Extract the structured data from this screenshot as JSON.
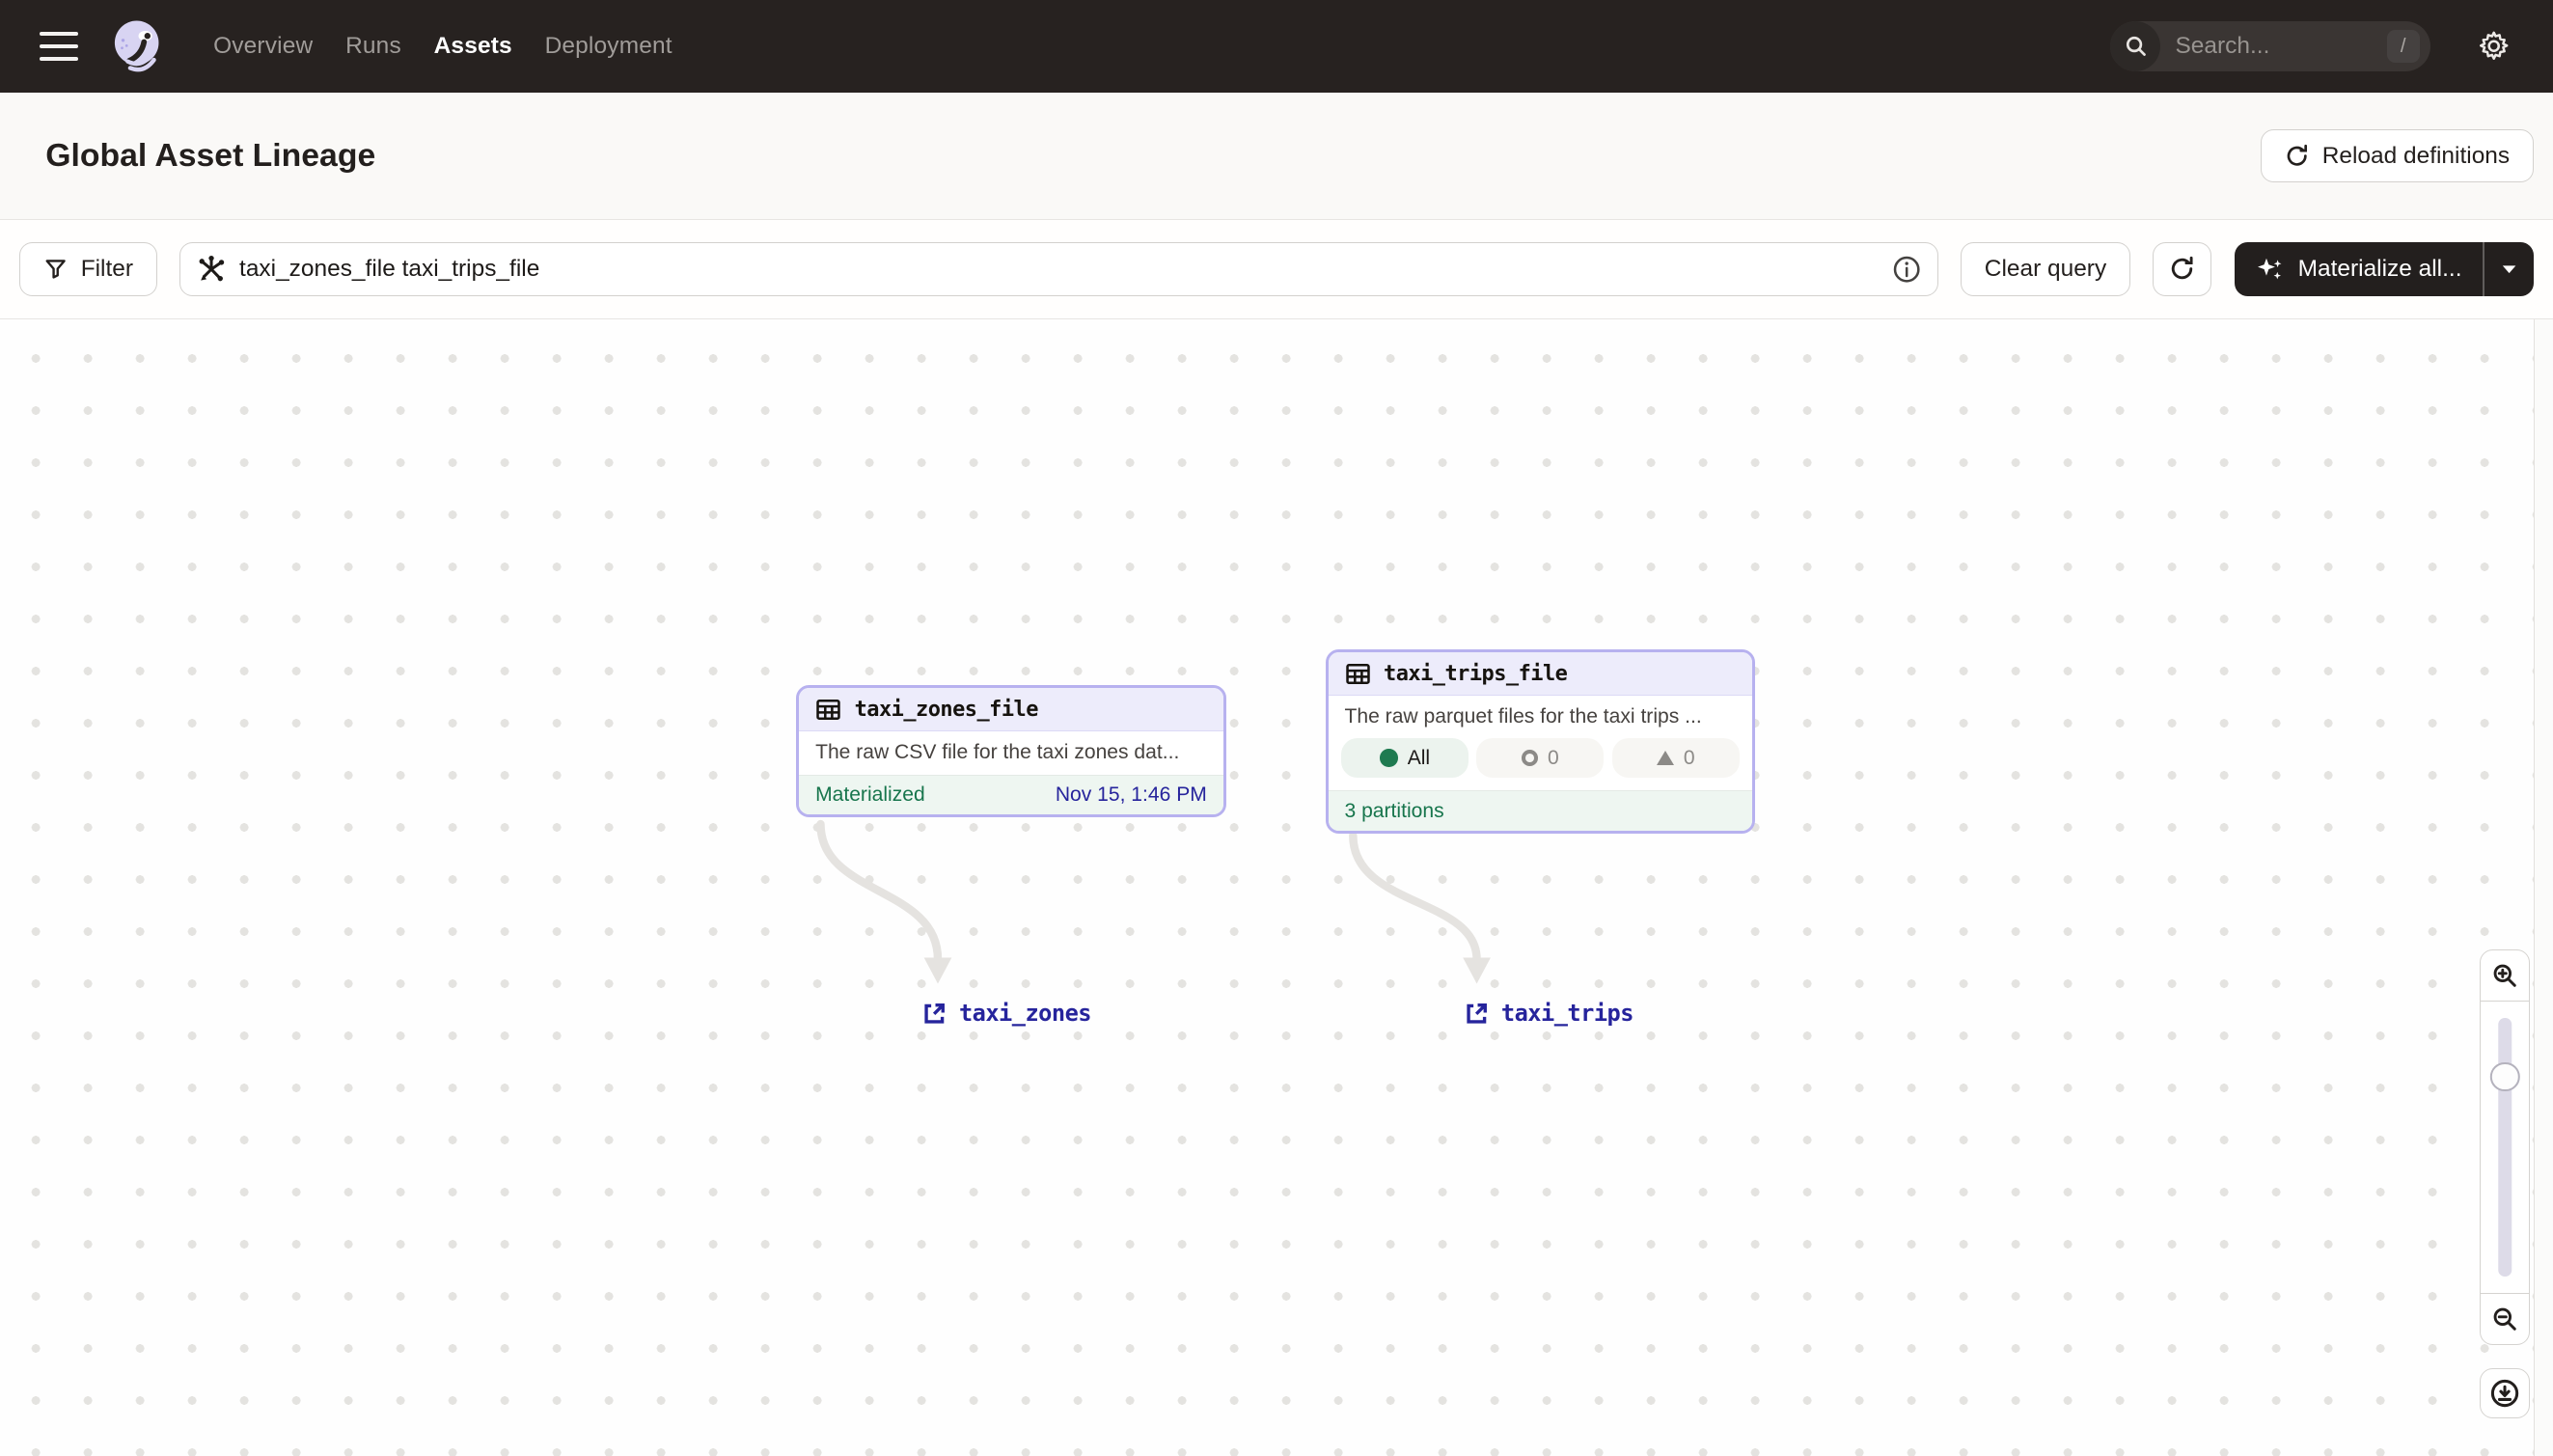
{
  "nav": {
    "items": [
      {
        "label": "Overview"
      },
      {
        "label": "Runs"
      },
      {
        "label": "Assets"
      },
      {
        "label": "Deployment"
      }
    ],
    "active_item": "Assets",
    "search": {
      "placeholder": "Search...",
      "shortcut": "/"
    }
  },
  "header": {
    "title": "Global Asset Lineage",
    "reload_button_label": "Reload definitions"
  },
  "toolbar": {
    "filter_label": "Filter",
    "query_value": "taxi_zones_file taxi_trips_file",
    "clear_query_label": "Clear query",
    "materialize_label": "Materialize all..."
  },
  "graph": {
    "nodes": [
      {
        "name": "taxi_zones_file",
        "description": "The raw CSV file for the taxi zones dat...",
        "status_label": "Materialized",
        "status_time": "Nov 15, 1:46 PM"
      },
      {
        "name": "taxi_trips_file",
        "description": "The raw parquet files for the taxi trips ...",
        "partition_pills": [
          {
            "label": "All",
            "state": "materialized"
          },
          {
            "label": "0",
            "state": "missing"
          },
          {
            "label": "0",
            "state": "failed"
          }
        ],
        "footer": "3 partitions"
      }
    ],
    "links": [
      {
        "label": "taxi_zones"
      },
      {
        "label": "taxi_trips"
      }
    ]
  },
  "colors": {
    "nav_dark": "#272220",
    "accent_lavender": "#b7b1ef",
    "status_green": "#17754c",
    "link_navy": "#26249c",
    "materialize_dark": "#231f1e"
  }
}
